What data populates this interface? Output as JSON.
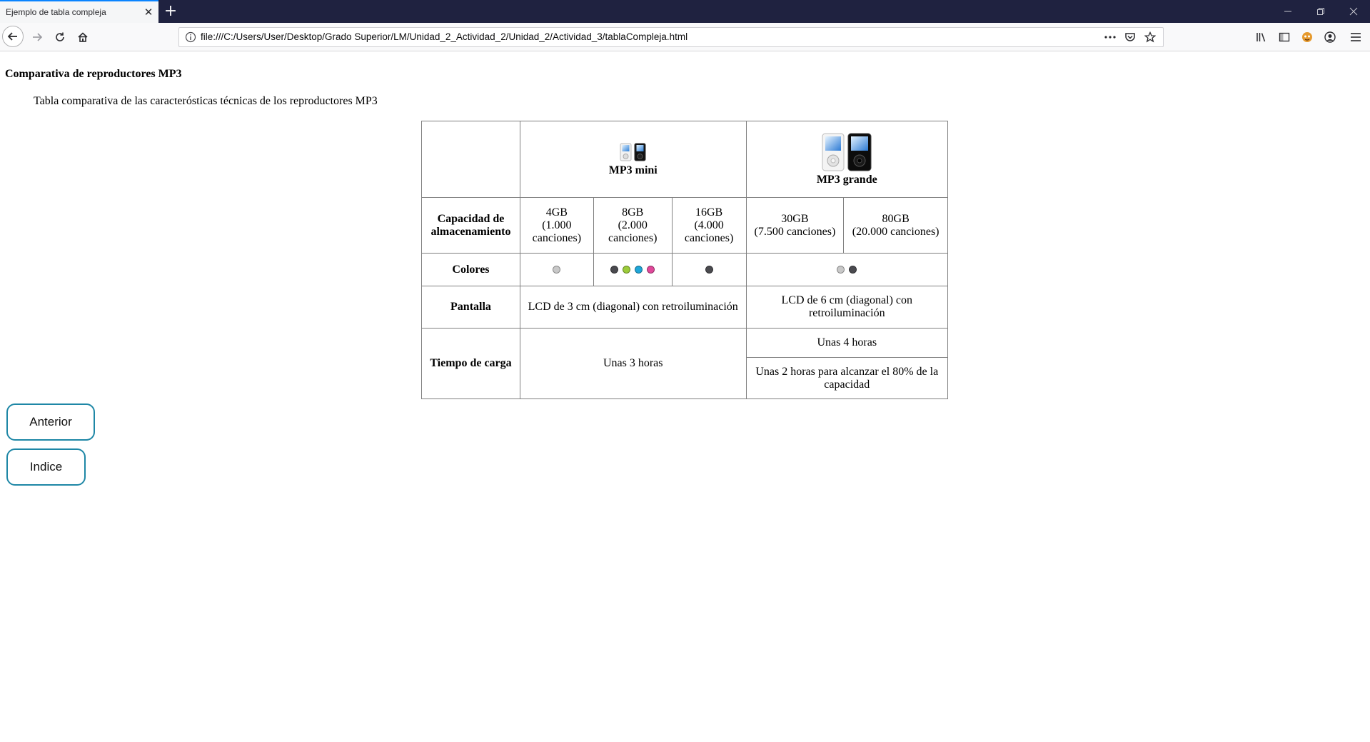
{
  "browser": {
    "tab_title": "Ejemplo de tabla compleja",
    "url": "file:///C:/Users/User/Desktop/Grado Superior/LM/Unidad_2_Actividad_2/Unidad_2/Actividad_3/tablaCompleja.html",
    "accent_color": "#0a84ff",
    "icons": [
      "back-icon",
      "forward-icon",
      "reload-icon",
      "home-icon",
      "info-icon",
      "more-icon",
      "pocket-icon",
      "bookmark-star-icon",
      "library-icon",
      "sidebar-icon",
      "extension-icon",
      "account-icon",
      "menu-icon"
    ]
  },
  "page": {
    "title": "Comparativa de reproductores MP3",
    "caption": "Tabla comparativa de las caracterósticas técnicas de los reproductores MP3",
    "table": {
      "mp3_mini": "MP3 mini",
      "mp3_grande": "MP3 grande",
      "capacity_header": "Capacidad de almacenamiento",
      "capacities": [
        {
          "size": "4GB",
          "songs": "(1.000 canciones)"
        },
        {
          "size": "8GB",
          "songs": "(2.000 canciones)"
        },
        {
          "size": "16GB",
          "songs": "(4.000 canciones)"
        },
        {
          "size": "30GB",
          "songs": "(7.500 canciones)"
        },
        {
          "size": "80GB",
          "songs": "(20.000 canciones)"
        }
      ],
      "colors_header": "Colores",
      "colors": {
        "mini_4gb": [
          "#c8c8c8"
        ],
        "mini_8gb": [
          "#4a4a4f",
          "#9ccc3a",
          "#1ea6d8",
          "#e0489a"
        ],
        "mini_16gb": [
          "#4a4a4f"
        ],
        "grande": [
          "#c8c8c8",
          "#4a4a4f"
        ]
      },
      "screen_header": "Pantalla",
      "screen_mini": "LCD de 3 cm (diagonal) con retroiluminación",
      "screen_grande": "LCD de 6 cm (diagonal) con retroiluminación",
      "charge_header": "Tiempo de carga",
      "charge_mini": "Unas 3 horas",
      "charge_grande_full": "Unas 4 horas",
      "charge_grande_80": "Unas 2 horas para alcanzar el 80% de la capacidad"
    },
    "buttons": {
      "anterior": "Anterior",
      "indice": "Indice"
    },
    "button_border_color": "#1e87a6"
  }
}
